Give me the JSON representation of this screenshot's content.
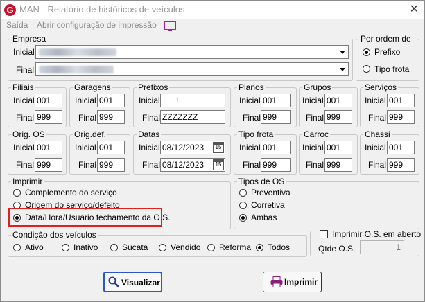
{
  "window": {
    "title": "MAN - Relatório de históricos de veículos",
    "close_glyph": "✕",
    "app_icon_letter": "G"
  },
  "menu": {
    "saida": "Saída",
    "abrir": "Abrir configuração de impressão",
    "monitor_icon": "monitor-icon"
  },
  "empresa": {
    "legend": "Empresa",
    "inicial_label": "Inicial",
    "final_label": "Final"
  },
  "ordem": {
    "legend": "Por ordem de",
    "options": [
      "Prefixo",
      "Tipo frota"
    ],
    "selected": "Prefixo"
  },
  "filters_row1": [
    {
      "legend": "Filiais",
      "inicial": "001",
      "final": "999"
    },
    {
      "legend": "Garagens",
      "inicial": "001",
      "final": "999"
    },
    {
      "legend": "Prefixos",
      "inicial": "!",
      "final": "ZZZZZZZ"
    },
    {
      "legend": "Planos",
      "inicial": "001",
      "final": "999"
    },
    {
      "legend": "Grupos",
      "inicial": "001",
      "final": "999"
    },
    {
      "legend": "Serviços",
      "inicial": "001",
      "final": "999"
    }
  ],
  "filters_row2": [
    {
      "legend": "Orig. OS",
      "inicial": "001",
      "final": "999"
    },
    {
      "legend": "Orig.def.",
      "inicial": "001",
      "final": "999"
    },
    {
      "legend": "Datas",
      "inicial": "08/12/2023",
      "final": "08/12/2023"
    },
    {
      "legend": "Tipo frota",
      "inicial": "001",
      "final": "999"
    },
    {
      "legend": "Carroc",
      "inicial": "001",
      "final": "999"
    },
    {
      "legend": "Chassi",
      "inicial": "001",
      "final": "999"
    }
  ],
  "labels": {
    "inicial": "Inicial",
    "final": "Final"
  },
  "calendar_glyph": "15",
  "imprimir": {
    "legend": "Imprimir",
    "options": [
      "Complemento do serviço",
      "Origem do serviço/defeito",
      "Data/Hora/Usuário fechamento da O.S."
    ],
    "selected": "Data/Hora/Usuário fechamento da O.S."
  },
  "tipos_os": {
    "legend": "Tipos de OS",
    "options": [
      "Preventiva",
      "Corretiva",
      "Ambas"
    ],
    "selected": "Ambas"
  },
  "condicao": {
    "legend": "Condição dos veículos",
    "options": [
      "Ativo",
      "Inativo",
      "Sucata",
      "Vendido",
      "Reforma",
      "Todos"
    ],
    "selected": "Todos"
  },
  "imprimir_aberto": {
    "label": "Imprimir O.S. em aberto",
    "checked": false,
    "qtde_label": "Qtde O.S.",
    "qtde_value": "1"
  },
  "buttons": {
    "visualizar": "Visualizar",
    "imprimir": "Imprimir"
  },
  "colors": {
    "highlight": "#e0201e",
    "focus": "#2a56c6",
    "brand": "#c8102e",
    "printer": "#8a1c7c"
  }
}
